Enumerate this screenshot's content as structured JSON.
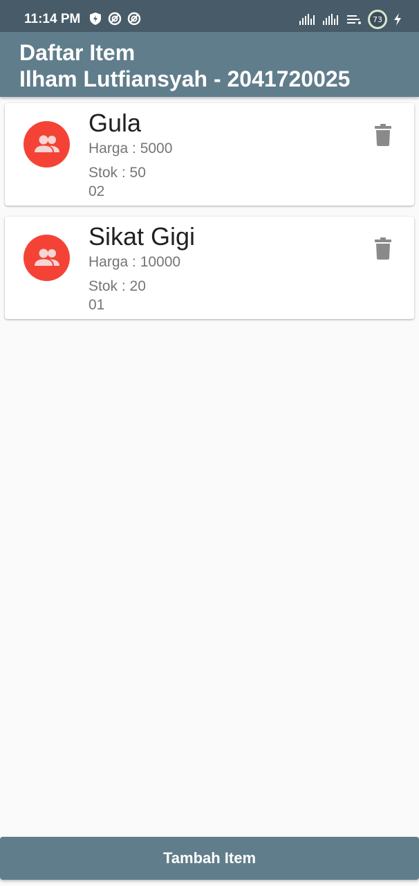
{
  "status_bar": {
    "time": "11:14 PM",
    "icons_left": [
      "shield-bolt-icon",
      "sync-icon",
      "sync-icon"
    ],
    "icons_right": [
      "signal-icon",
      "signal-icon",
      "data-icon",
      "battery-icon",
      "charging-icon"
    ],
    "battery_level": "73"
  },
  "app_bar": {
    "title_line1": "Daftar Item",
    "title_line2": "Ilham Lutfiansyah - 2041720025"
  },
  "items": [
    {
      "name": "Gula",
      "price": "Harga : 5000",
      "stock": "Stok : 50",
      "code": "02"
    },
    {
      "name": "Sikat Gigi",
      "price": "Harga : 10000",
      "stock": "Stok : 20",
      "code": "01"
    }
  ],
  "bottom_button": {
    "label": "Tambah Item"
  },
  "colors": {
    "primary": "#607d8b",
    "status_bar": "#475c68",
    "avatar": "#f44336",
    "icon_grey": "#8a8a8a"
  }
}
